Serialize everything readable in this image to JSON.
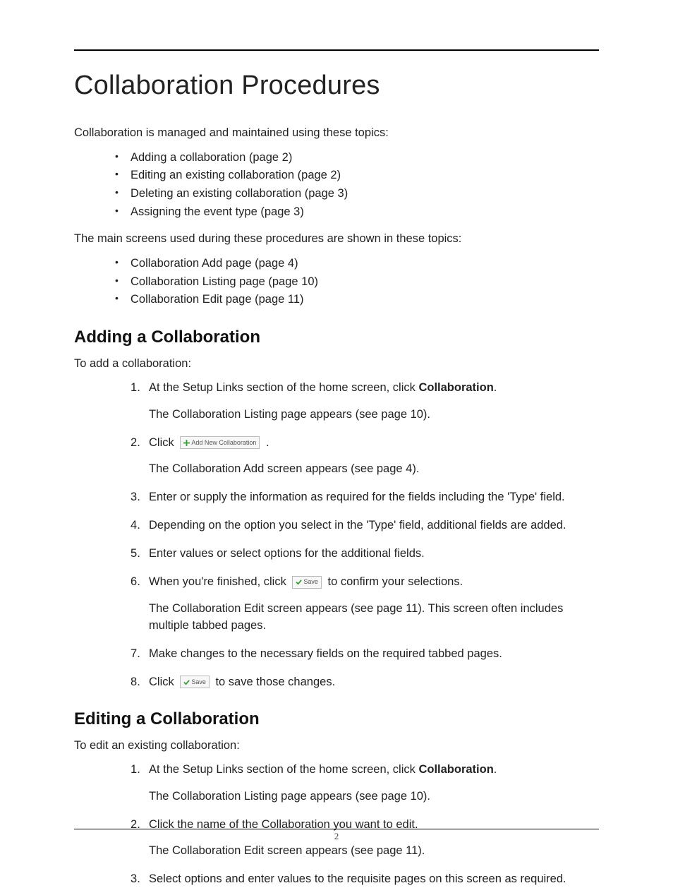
{
  "title": "Collaboration Procedures",
  "intro1": "Collaboration is managed and maintained using these topics:",
  "topics": [
    "Adding a collaboration (page 2)",
    "Editing an existing collaboration (page 2)",
    "Deleting an existing collaboration (page 3)",
    "Assigning the event type (page 3)"
  ],
  "intro2": "The main screens used during these procedures are shown in these topics:",
  "screens": [
    "Collaboration Add page (page 4)",
    "Collaboration Listing page (page 10)",
    "Collaboration Edit page (page 11)"
  ],
  "section1": {
    "heading": "Adding a Collaboration",
    "lead": "To add a collaboration:",
    "steps": {
      "s1_prefix": "At the Setup Links section of the home screen, click ",
      "s1_bold": "Collaboration",
      "s1_suffix": ".",
      "s1_sub": "The Collaboration Listing page appears (see page 10).",
      "s2_prefix": "Click ",
      "s2_btn": "Add New Collaboration",
      "s2_suffix": " .",
      "s2_sub": "The Collaboration Add screen appears (see page 4).",
      "s3": "Enter or supply the information as required for the fields including the 'Type' field.",
      "s4": "Depending on the option you select in the 'Type' field, additional fields are added.",
      "s5": "Enter values or select options for the additional fields.",
      "s6_prefix": "When you're finished, click ",
      "s6_btn": "Save",
      "s6_suffix": " to confirm your selections.",
      "s6_sub": "The Collaboration Edit screen appears (see page 11). This screen often includes multiple tabbed pages.",
      "s7": "Make changes to the necessary fields on the required tabbed pages.",
      "s8_prefix": "Click ",
      "s8_btn": "Save",
      "s8_suffix": " to save those changes."
    }
  },
  "section2": {
    "heading": "Editing a Collaboration",
    "lead": "To edit an existing collaboration:",
    "steps": {
      "s1_prefix": "At the Setup Links section of the home screen, click ",
      "s1_bold": "Collaboration",
      "s1_suffix": ".",
      "s1_sub": "The Collaboration Listing page appears (see page 10).",
      "s2": "Click the name of the Collaboration you want to edit.",
      "s2_sub": "The Collaboration Edit screen appears (see page 11).",
      "s3": "Select options and enter values to the requisite pages on this screen as required."
    }
  },
  "page_number": "2"
}
